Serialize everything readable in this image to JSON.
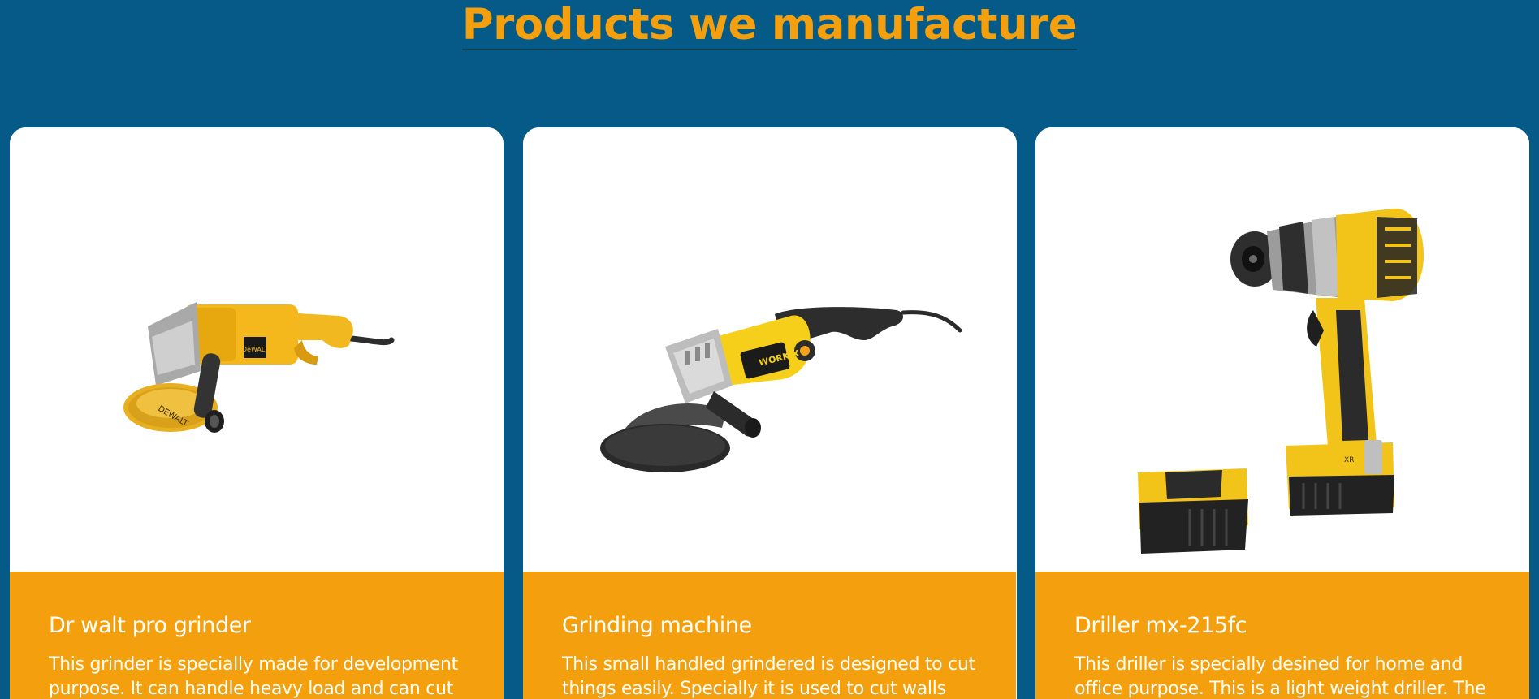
{
  "section": {
    "title": "Products we manufacture"
  },
  "products": [
    {
      "title": "Dr walt pro grinder",
      "description": "This grinder is specially made for development purpose. It can handle heavy load and can cut",
      "image_icon": "angle-grinder-dewalt-icon",
      "brand_mark": "DeWALT"
    },
    {
      "title": "Grinding machine",
      "description": "This small handled grindered is designed to cut things easily. Specially it is used to cut walls and",
      "image_icon": "angle-grinder-workx-icon",
      "brand_mark": "WORK X"
    },
    {
      "title": "Driller mx-215fc",
      "description": "This driller is specially desined for home and office purpose. This is a light weight driller. The",
      "image_icon": "cordless-drill-icon",
      "brand_mark": "XR"
    }
  ],
  "colors": {
    "background": "#055a87",
    "accent": "#f4a00e",
    "card": "#ffffff",
    "text_on_accent": "#ffffff"
  }
}
